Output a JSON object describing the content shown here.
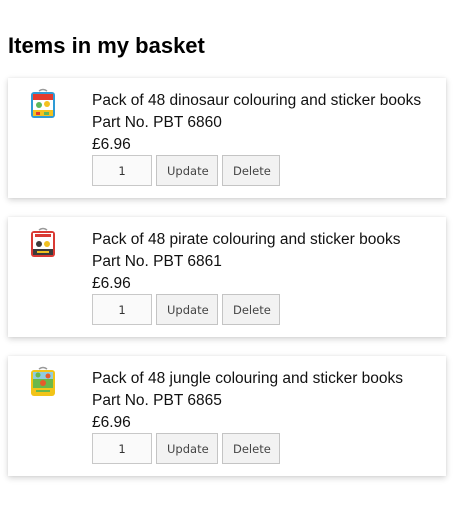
{
  "page": {
    "title": "Items in my basket"
  },
  "basket": {
    "items": [
      {
        "name": "Pack of 48 dinosaur colouring and sticker books",
        "part_no": "Part No. PBT 6860",
        "price": "£6.96",
        "quantity": "1",
        "update_label": "Update",
        "delete_label": "Delete",
        "thumbnail_icon": "dinosaur-book-thumbnail",
        "thumbnail_colors": [
          "#2e9bd6",
          "#e23b2e",
          "#f4c21f",
          "#5cb85c"
        ]
      },
      {
        "name": "Pack of 48 pirate colouring and sticker books",
        "part_no": "Part No. PBT 6861",
        "price": "£6.96",
        "quantity": "1",
        "update_label": "Update",
        "delete_label": "Delete",
        "thumbnail_icon": "pirate-book-thumbnail",
        "thumbnail_colors": [
          "#d93a34",
          "#ffffff",
          "#3b3b3b",
          "#f0c020"
        ]
      },
      {
        "name": "Pack of 48 jungle colouring and sticker books",
        "part_no": "Part No. PBT 6865",
        "price": "£6.96",
        "quantity": "1",
        "update_label": "Update",
        "delete_label": "Delete",
        "thumbnail_icon": "jungle-book-thumbnail",
        "thumbnail_colors": [
          "#f2c418",
          "#6bb84a",
          "#e85a2a",
          "#8fcce0"
        ]
      }
    ]
  }
}
